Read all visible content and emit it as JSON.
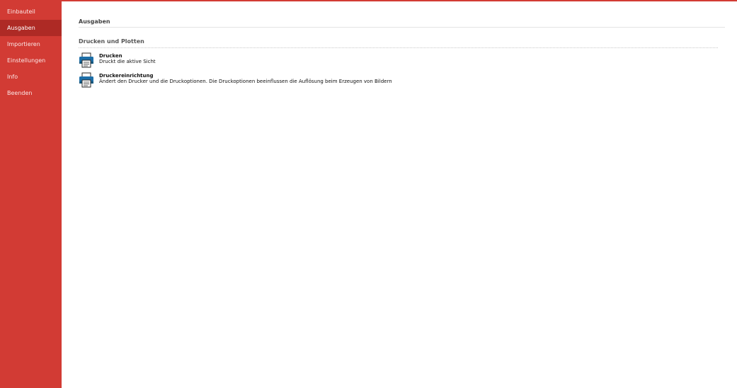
{
  "sidebar": {
    "items": [
      {
        "label": "Einbauteil"
      },
      {
        "label": "Ausgaben"
      },
      {
        "label": "Importieren"
      },
      {
        "label": "Einstellungen"
      },
      {
        "label": "Info"
      },
      {
        "label": "Beenden"
      }
    ],
    "selected": "Ausgaben"
  },
  "main": {
    "title": "Ausgaben",
    "section": {
      "title": "Drucken und Plotten",
      "commands": [
        {
          "icon": "printer-icon",
          "title": "Drucken",
          "description": "Druckt die aktive Sicht"
        },
        {
          "icon": "printer-setup-icon",
          "title": "Druckereinrichtung",
          "description": "Ändert den Drucker und die Druckoptionen. Die Druckoptionen beeinflussen die Auflösung beim Erzeugen von Bildern"
        }
      ]
    }
  },
  "colors": {
    "accent": "#d23b34",
    "accent_selected": "#ae2a25",
    "icon_blue": "#1e6fa8"
  }
}
